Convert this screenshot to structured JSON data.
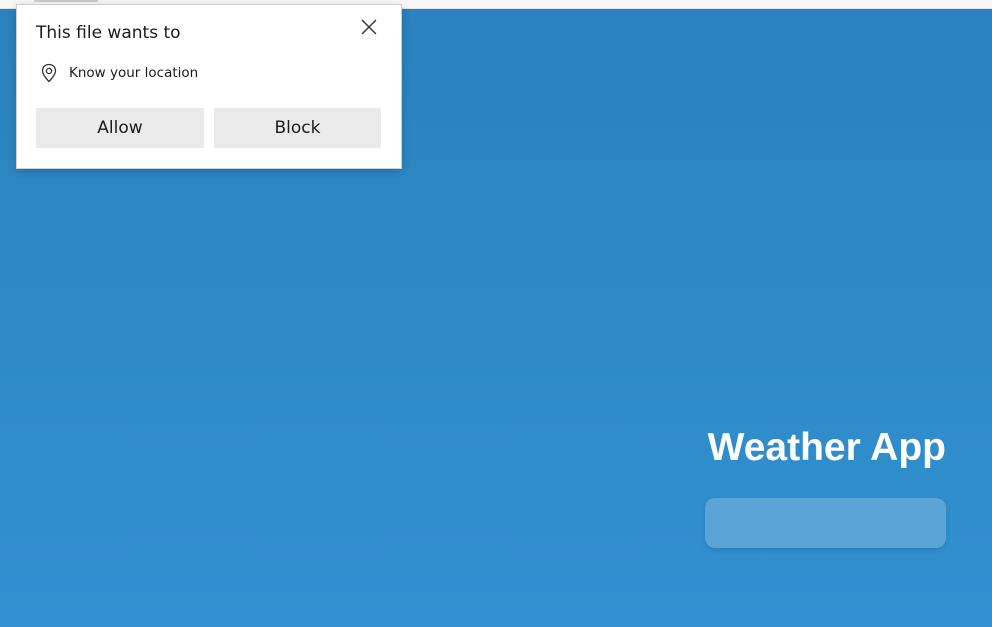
{
  "app": {
    "title": "Weather App",
    "search_placeholder": "",
    "background_color": "#2e8bc8"
  },
  "permission_prompt": {
    "title": "This file wants to",
    "permission_label": "Know your location",
    "permission_icon": "location-pin-icon",
    "close_icon": "close-icon",
    "allow_label": "Allow",
    "block_label": "Block",
    "button_color": "#eaeaea"
  }
}
